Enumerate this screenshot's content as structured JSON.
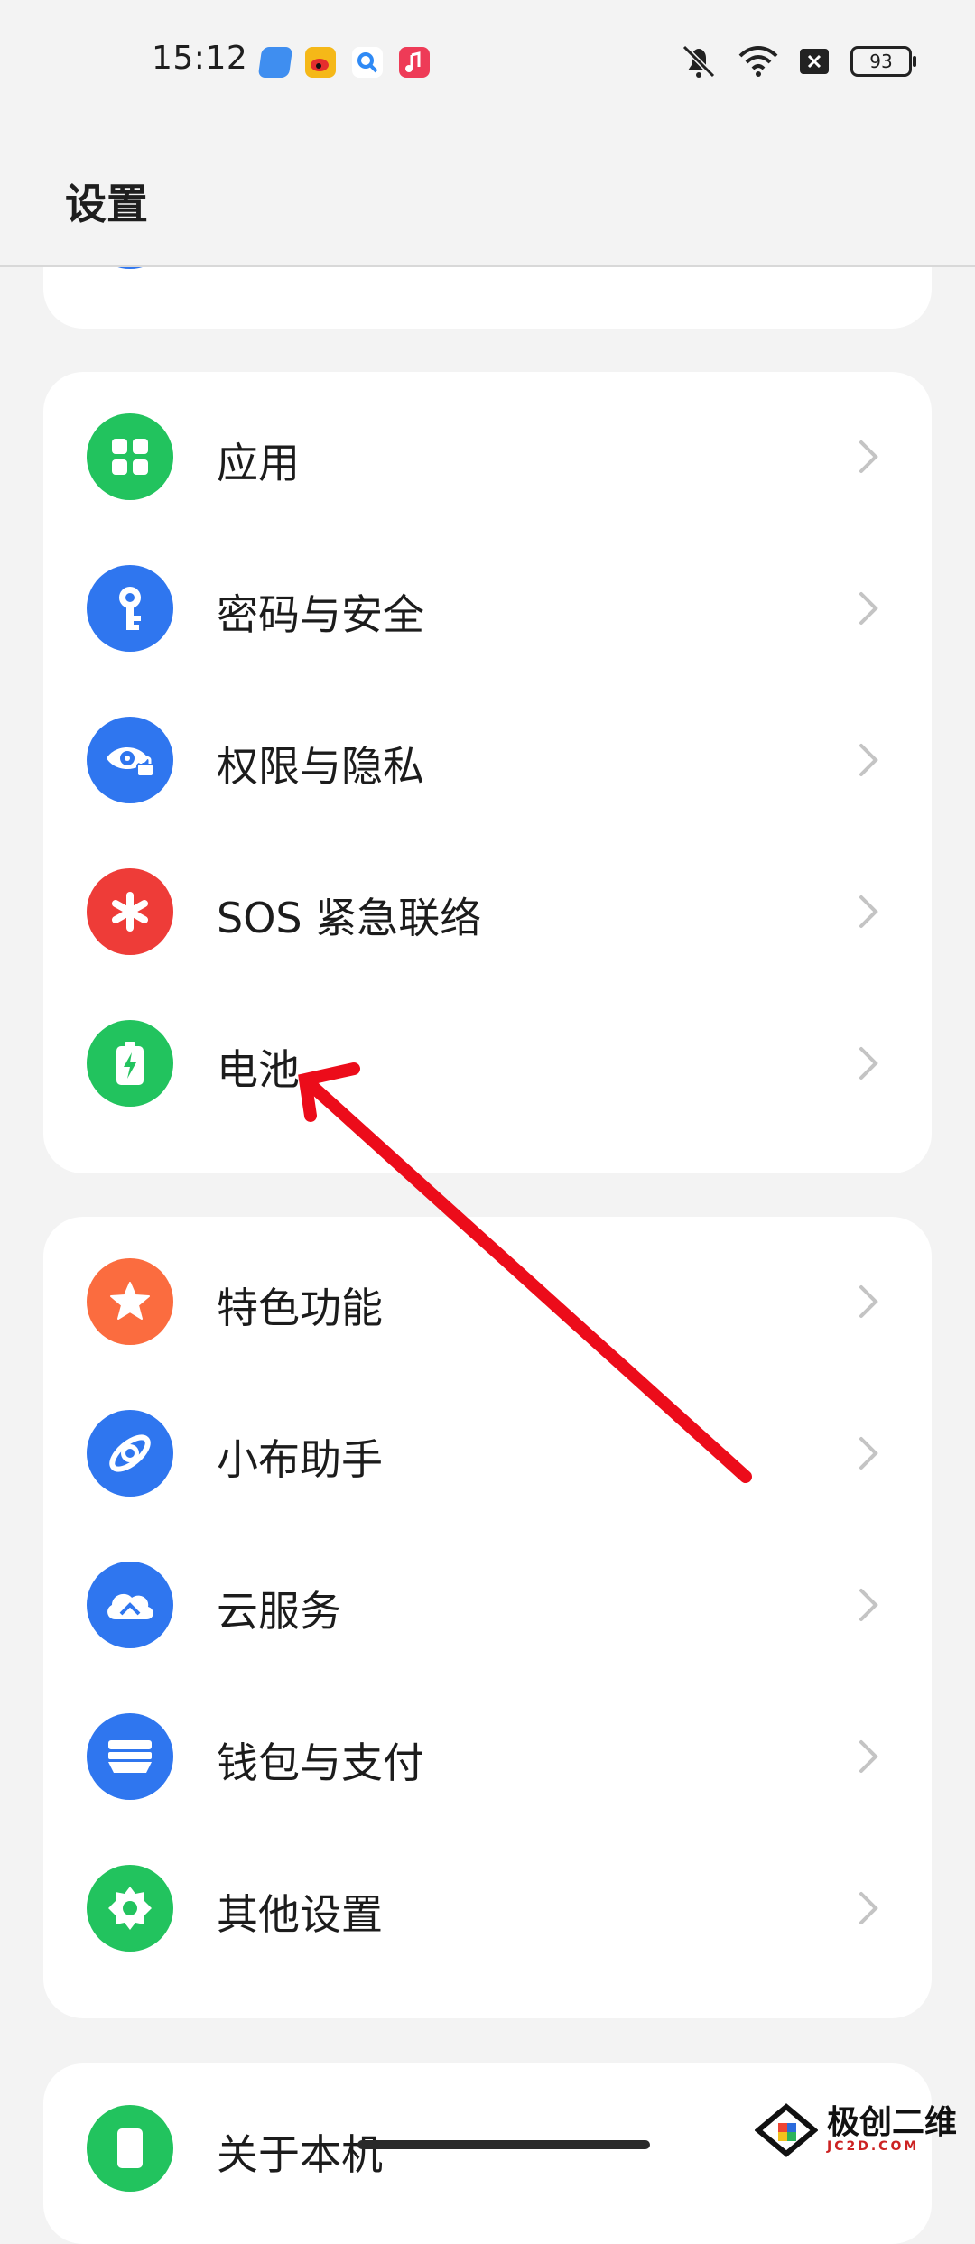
{
  "status_bar": {
    "time": "15:12",
    "notification_icons": [
      "app-icon",
      "weibo-icon",
      "search-app-icon",
      "music-icon"
    ],
    "system_icons": [
      "mute-icon",
      "wifi-icon",
      "sim-blocked-icon"
    ],
    "battery": "93"
  },
  "header": {
    "title": "设置"
  },
  "groups": [
    {
      "items": [
        {
          "label": "应用",
          "icon": "apps-grid-icon",
          "color": "#22c35e"
        },
        {
          "label": "密码与安全",
          "icon": "key-icon",
          "color": "#2f76ef"
        },
        {
          "label": "权限与隐私",
          "icon": "privacy-eye-icon",
          "color": "#2f76ef"
        },
        {
          "label": "SOS 紧急联络",
          "icon": "sos-asterisk-icon",
          "color": "#ee3c38"
        },
        {
          "label": "电池",
          "icon": "battery-icon",
          "color": "#22c35e"
        }
      ]
    },
    {
      "items": [
        {
          "label": "特色功能",
          "icon": "star-icon",
          "color": "#fb6c3f"
        },
        {
          "label": "小布助手",
          "icon": "assistant-icon",
          "color": "#2f76ef"
        },
        {
          "label": "云服务",
          "icon": "cloud-icon",
          "color": "#2f76ef"
        },
        {
          "label": "钱包与支付",
          "icon": "wallet-icon",
          "color": "#2f76ef"
        },
        {
          "label": "其他设置",
          "icon": "gear-icon",
          "color": "#22c35e"
        }
      ]
    },
    {
      "items": [
        {
          "label": "关于本机",
          "icon": "phone-icon",
          "color": "#22c35e"
        }
      ]
    }
  ],
  "watermark": {
    "text": "极创二维",
    "sub": "JC2D.COM"
  }
}
